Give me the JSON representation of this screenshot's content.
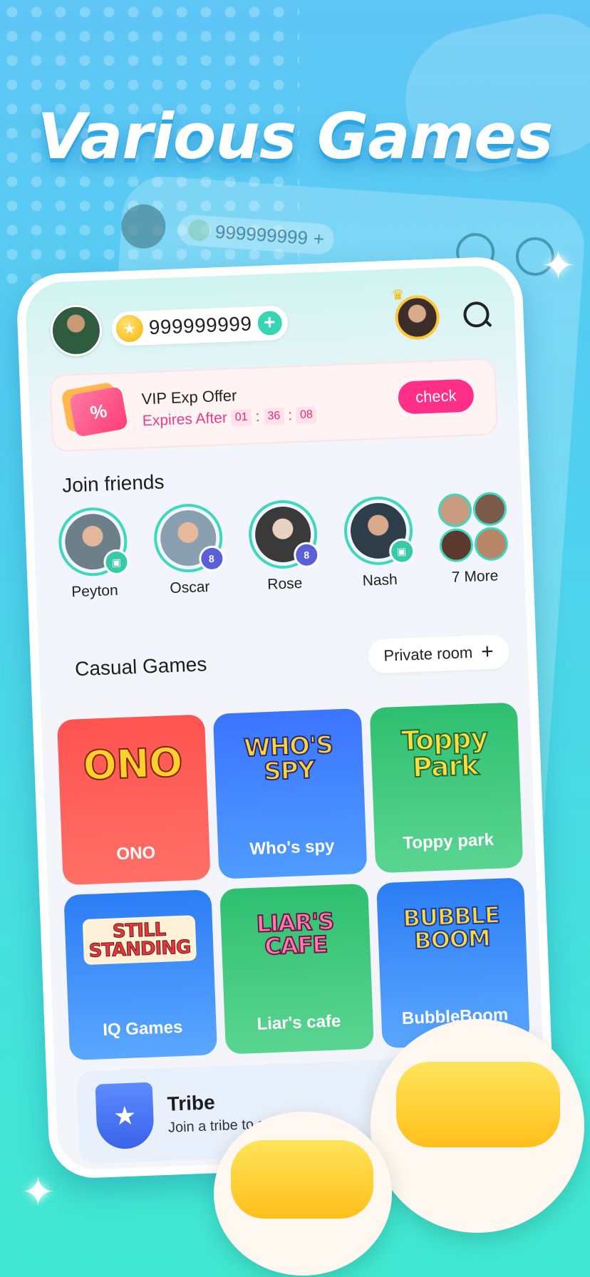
{
  "hero": {
    "title": "Various Games"
  },
  "ghost": {
    "coins": "999999999",
    "plus": "+"
  },
  "header": {
    "coins": "999999999",
    "plus": "+",
    "coin_icon": "coin-icon",
    "search_icon": "search-icon"
  },
  "vip": {
    "title": "VIP Exp Offer",
    "expires_label": "Expires After",
    "timer": {
      "h": "01",
      "m": "36",
      "s": "08",
      "sep": ":"
    },
    "button": "check",
    "icon": "coupon-icon"
  },
  "friends": {
    "title": "Join friends",
    "items": [
      {
        "name": "Peyton",
        "badge": "gift",
        "badge_color": "#38c9a8"
      },
      {
        "name": "Oscar",
        "badge": "8",
        "badge_color": "#5b5fd8"
      },
      {
        "name": "Rose",
        "badge": "8",
        "badge_color": "#5b5fd8"
      },
      {
        "name": "Nash",
        "badge": "gift",
        "badge_color": "#38c9a8"
      }
    ],
    "more": "7 More"
  },
  "games": {
    "title": "Casual Games",
    "private_room": "Private room",
    "private_room_icon": "+",
    "items": [
      {
        "logo": "ONO",
        "label": "ONO",
        "theme": "red"
      },
      {
        "logo": "WHO'S SPY",
        "label": "Who's spy",
        "theme": "blue"
      },
      {
        "logo": "Toppy Park",
        "label": "Toppy park",
        "theme": "green"
      },
      {
        "logo": "STILL STANDING",
        "label": "IQ Games",
        "theme": "blue"
      },
      {
        "logo": "LIAR'S CAFE",
        "label": "Liar's cafe",
        "theme": "green"
      },
      {
        "logo": "BUBBLE BOOM",
        "label": "BubbleBoom",
        "theme": "blue"
      }
    ]
  },
  "tribe": {
    "title": "Tribe",
    "subtitle": "Join a tribe to get",
    "icon": "star-shield-icon"
  },
  "colors": {
    "accent": "#36d6b2",
    "pink": "#ff2f88",
    "ring": "#3ed7c0"
  }
}
